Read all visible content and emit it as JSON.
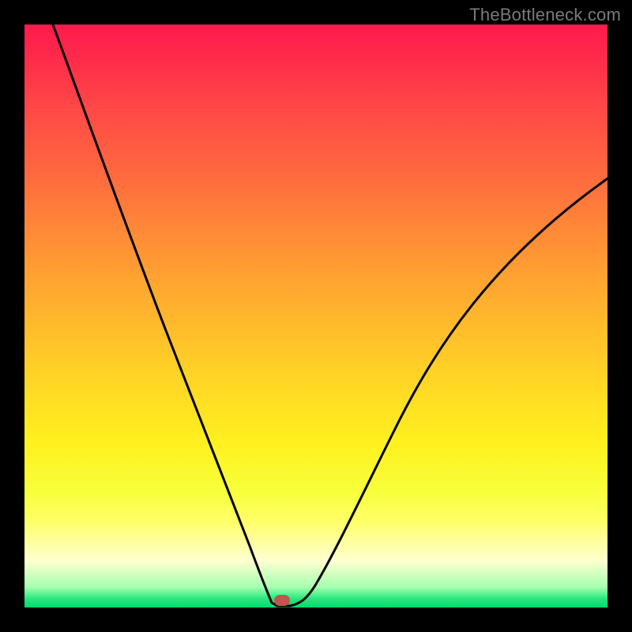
{
  "watermark": "TheBottleneck.com",
  "colors": {
    "frame": "#000000",
    "curve": "#000000",
    "marker": "#c1554f",
    "gradient_stops": [
      "#ff1a4d",
      "#ff4747",
      "#ff8b37",
      "#ffd326",
      "#fff11f",
      "#fdffd0",
      "#26e87e",
      "#00db6e"
    ]
  },
  "chart_data": {
    "type": "line",
    "title": "",
    "xlabel": "",
    "ylabel": "",
    "xlim": [
      0,
      100
    ],
    "ylim": [
      0,
      100
    ],
    "series": [
      {
        "name": "left-branch",
        "x": [
          5,
          10,
          15,
          20,
          25,
          30,
          35,
          40,
          42
        ],
        "values": [
          100,
          86,
          72,
          58,
          44,
          31,
          19,
          6,
          0
        ]
      },
      {
        "name": "right-branch",
        "x": [
          45,
          48,
          52,
          58,
          64,
          72,
          80,
          90,
          100
        ],
        "values": [
          0,
          3,
          8,
          17,
          27,
          39,
          51,
          64,
          74
        ]
      }
    ],
    "annotations": [
      {
        "name": "optimum-marker",
        "x": 43,
        "y": 0
      }
    ],
    "gradient_axis": "y",
    "gradient_meaning": "bottleneck-severity"
  }
}
